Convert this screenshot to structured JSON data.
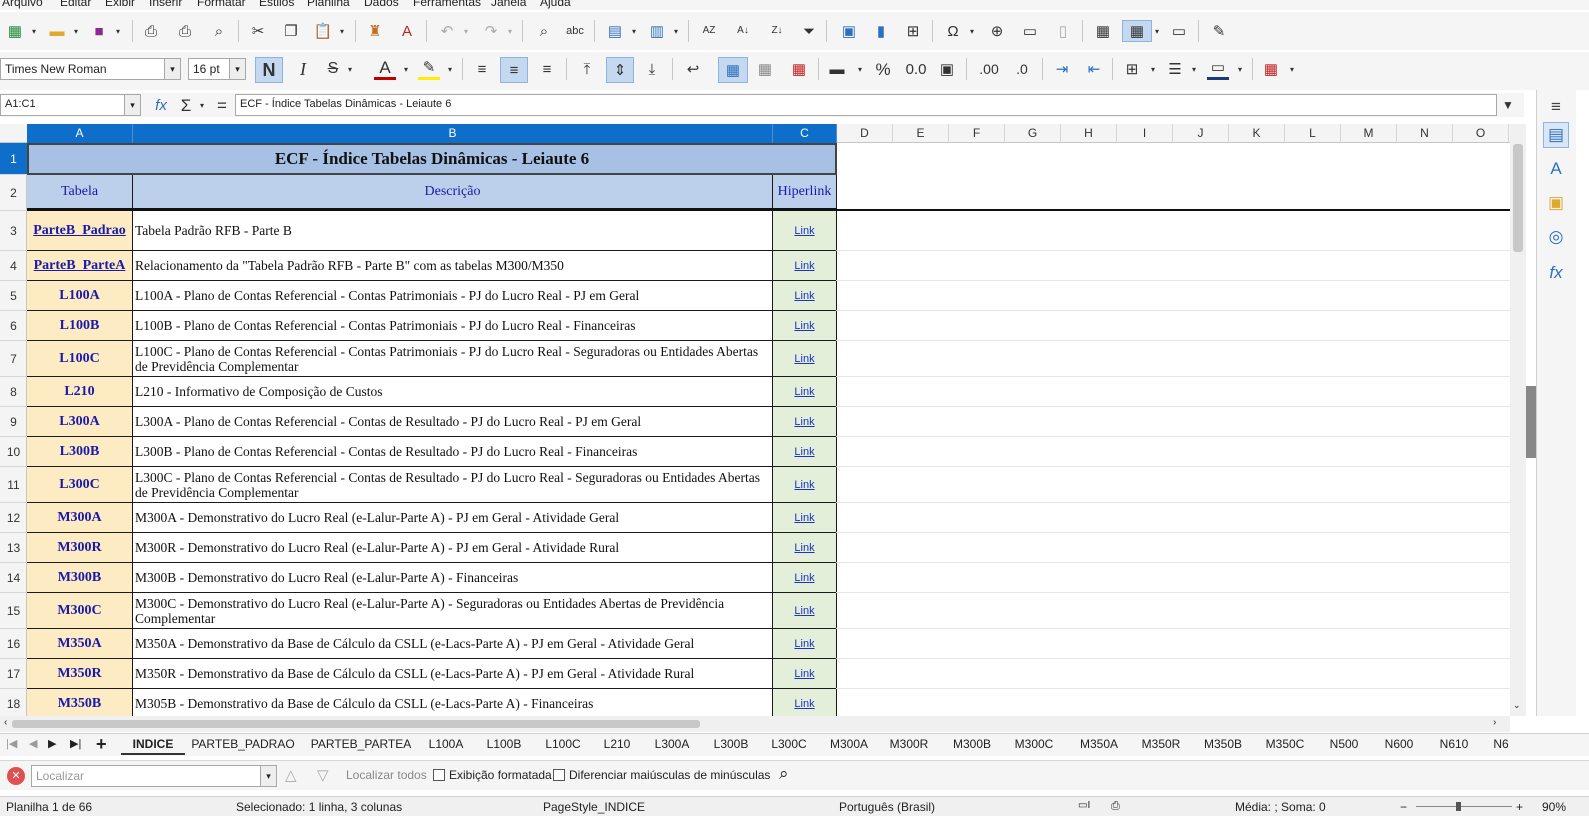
{
  "menu": [
    "Arquivo",
    "Editar",
    "Exibir",
    "Inserir",
    "Formatar",
    "Estilos",
    "Planilha",
    "Dados",
    "Ferramentas",
    "Janela",
    "Ajuda"
  ],
  "format": {
    "font_name": "Times New Roman",
    "font_size": "16 pt",
    "bold": "N",
    "italic": "I",
    "strike": "S",
    "font_color_glyph": "A",
    "percent": "%",
    "number": "0.0",
    "add_decimal": ".00",
    "del_decimal": ".0"
  },
  "formula": {
    "name_box": "A1:C1",
    "fx": "fx",
    "sum": "Σ",
    "equals": "=",
    "content": "ECF - Índice Tabelas Dinâmicas - Leiaute 6"
  },
  "columns": [
    "A",
    "B",
    "C",
    "D",
    "E",
    "F",
    "G",
    "H",
    "I",
    "J",
    "K",
    "L",
    "M",
    "N",
    "O"
  ],
  "sheet": {
    "title": "ECF - Índice Tabelas Dinâmicas - Leiaute 6",
    "headers": [
      "Tabela",
      "Descrição",
      "Hiperlink"
    ],
    "link_text": "Link",
    "rows": [
      {
        "n": "3",
        "tabela": "ParteB_Padrao",
        "desc": "Tabela Padrão RFB - Parte B"
      },
      {
        "n": "4",
        "tabela": "ParteB_ParteA",
        "desc": "Relacionamento da \"Tabela Padrão RFB - Parte B\" com as tabelas M300/M350"
      },
      {
        "n": "5",
        "tabela": "L100A",
        "desc": "L100A - Plano de Contas Referencial - Contas Patrimoniais - PJ do Lucro Real - PJ em Geral"
      },
      {
        "n": "6",
        "tabela": "L100B",
        "desc": "L100B - Plano de Contas Referencial - Contas Patrimoniais - PJ do Lucro Real - Financeiras"
      },
      {
        "n": "7",
        "tabela": "L100C",
        "desc": "L100C - Plano de Contas Referencial - Contas Patrimoniais - PJ do Lucro Real - Seguradoras ou Entidades Abertas de Previdência Complementar"
      },
      {
        "n": "8",
        "tabela": "L210",
        "desc": "L210 - Informativo de Composição de Custos"
      },
      {
        "n": "9",
        "tabela": "L300A",
        "desc": "L300A - Plano de Contas Referencial - Contas de Resultado - PJ do Lucro Real - PJ em Geral"
      },
      {
        "n": "10",
        "tabela": "L300B",
        "desc": "L300B - Plano de Contas Referencial - Contas de Resultado - PJ do Lucro Real - Financeiras"
      },
      {
        "n": "11",
        "tabela": "L300C",
        "desc": "L300C - Plano de Contas Referencial - Contas de Resultado - PJ do Lucro Real - Seguradoras ou Entidades Abertas de Previdência Complementar"
      },
      {
        "n": "12",
        "tabela": "M300A",
        "desc": "M300A - Demonstrativo do Lucro Real (e-Lalur-Parte A) - PJ em Geral - Atividade Geral"
      },
      {
        "n": "13",
        "tabela": "M300R",
        "desc": "M300R - Demonstrativo do Lucro Real (e-Lalur-Parte A) - PJ em Geral - Atividade Rural"
      },
      {
        "n": "14",
        "tabela": "M300B",
        "desc": "M300B - Demonstrativo do Lucro Real (e-Lalur-Parte A) - Financeiras"
      },
      {
        "n": "15",
        "tabela": "M300C",
        "desc": "M300C - Demonstrativo do Lucro Real (e-Lalur-Parte A) - Seguradoras ou Entidades Abertas de Previdência Complementar"
      },
      {
        "n": "16",
        "tabela": "M350A",
        "desc": "M350A - Demonstrativo da Base de Cálculo da CSLL (e-Lacs-Parte A) - PJ em Geral - Atividade Geral"
      },
      {
        "n": "17",
        "tabela": "M350R",
        "desc": "M350R - Demonstrativo da Base de Cálculo da CSLL (e-Lacs-Parte A) - PJ em Geral - Atividade Rural"
      },
      {
        "n": "18",
        "tabela": "M350B",
        "desc": "M305B - Demonstrativo da Base de Cálculo da CSLL (e-Lacs-Parte A) - Financeiras"
      }
    ]
  },
  "tabs": [
    "INDICE",
    "PARTEB_PADRAO",
    "PARTEB_PARTEA",
    "L100A",
    "L100B",
    "L100C",
    "L210",
    "L300A",
    "L300B",
    "L300C",
    "M300A",
    "M300R",
    "M300B",
    "M300C",
    "M350A",
    "M350R",
    "M350B",
    "M350C",
    "N500",
    "N600",
    "N610",
    "N6"
  ],
  "active_tab": "INDICE",
  "find": {
    "placeholder": "Localizar",
    "find_all": "Localizar todos",
    "formatted": "Exibição formatada",
    "match_case": "Diferenciar maiúsculas de minúsculas"
  },
  "status": {
    "sheet": "Planilha 1 de 66",
    "selection": "Selecionado: 1 linha, 3 colunas",
    "page_style": "PageStyle_INDICE",
    "language": "Português (Brasil)",
    "sum": "Média: ; Soma: 0",
    "zoom": "90%"
  }
}
